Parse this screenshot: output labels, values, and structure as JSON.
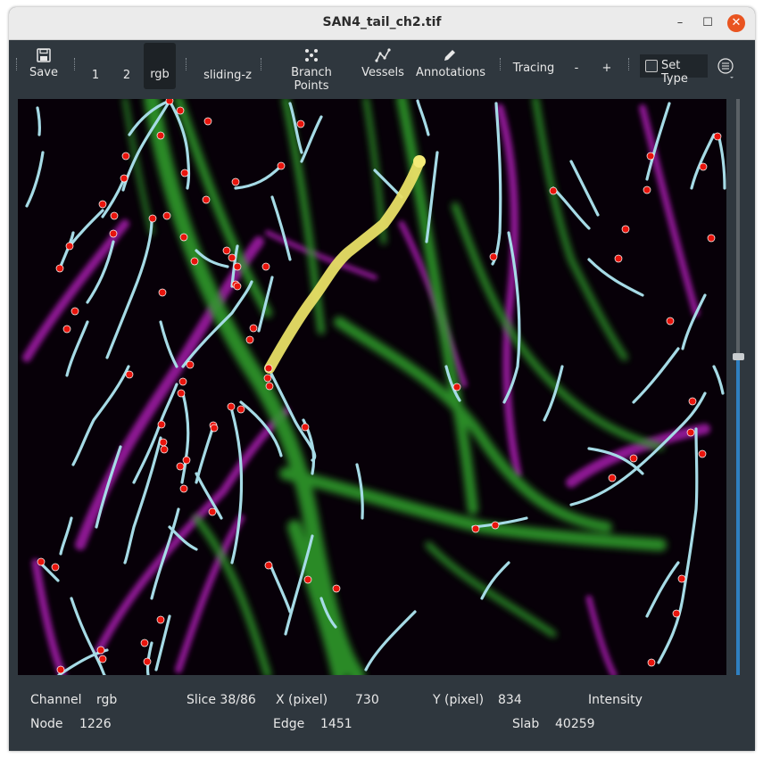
{
  "window": {
    "title": "SAN4_tail_ch2.tif",
    "minimize": "–",
    "maximize": "☐",
    "close": "✕"
  },
  "toolbar": {
    "save_label": "Save",
    "ch1_label": "1",
    "ch2_label": "2",
    "rgb_label": "rgb",
    "sliding_label": "sliding-z",
    "branch_label": "Branch Points",
    "vessels_label": "Vessels",
    "annotations_label": "Annotations",
    "tracing_label": "Tracing",
    "minus_label": "-",
    "plus_label": "+",
    "settype_label": "Set Type"
  },
  "status": {
    "channel_label": "Channel",
    "channel_value": "rgb",
    "slice_label": "Slice 38/86",
    "x_label": "X (pixel)",
    "x_value": "730",
    "y_label": "Y (pixel)",
    "y_value": "834",
    "intensity_label": "Intensity",
    "node_label": "Node",
    "node_value": "1226",
    "edge_label": "Edge",
    "edge_value": "1451",
    "slab_label": "Slab",
    "slab_value": "40259"
  },
  "colors": {
    "background": "#000000",
    "vessel_green": "#3aa832",
    "vessel_magenta": "#b01fb6",
    "trace_cyan": "#a6dbe6",
    "node_red": "#e8140c",
    "selected_trace": "#f0e45a",
    "accent_blue": "#2f7fc0"
  },
  "slice_slider": {
    "value": 38,
    "max": 86
  }
}
